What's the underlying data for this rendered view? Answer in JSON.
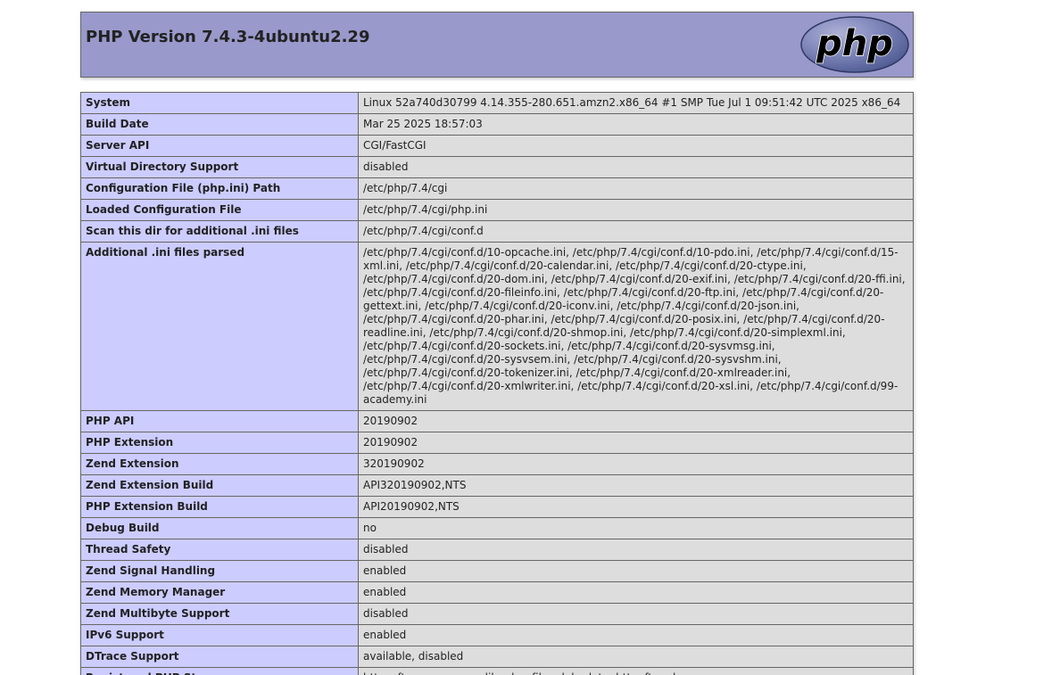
{
  "header": {
    "title": "PHP Version 7.4.3-4ubuntu2.29",
    "logo_text": "php",
    "logo_icon": "php-logo-icon",
    "bg_color": "#9999cc"
  },
  "colors": {
    "label_cell": "#ccccff",
    "value_cell": "#dddddd",
    "border": "#666666"
  },
  "rows": [
    {
      "label": "System",
      "value": "Linux 52a740d30799 4.14.355-280.651.amzn2.x86_64 #1 SMP Tue Jul 1 09:51:42 UTC 2025 x86_64"
    },
    {
      "label": "Build Date",
      "value": "Mar 25 2025 18:57:03"
    },
    {
      "label": "Server API",
      "value": "CGI/FastCGI"
    },
    {
      "label": "Virtual Directory Support",
      "value": "disabled"
    },
    {
      "label": "Configuration File (php.ini) Path",
      "value": "/etc/php/7.4/cgi"
    },
    {
      "label": "Loaded Configuration File",
      "value": "/etc/php/7.4/cgi/php.ini"
    },
    {
      "label": "Scan this dir for additional .ini files",
      "value": "/etc/php/7.4/cgi/conf.d"
    },
    {
      "label": "Additional .ini files parsed",
      "value": "/etc/php/7.4/cgi/conf.d/10-opcache.ini, /etc/php/7.4/cgi/conf.d/10-pdo.ini, /etc/php/7.4/cgi/conf.d/15-xml.ini, /etc/php/7.4/cgi/conf.d/20-calendar.ini, /etc/php/7.4/cgi/conf.d/20-ctype.ini, /etc/php/7.4/cgi/conf.d/20-dom.ini, /etc/php/7.4/cgi/conf.d/20-exif.ini, /etc/php/7.4/cgi/conf.d/20-ffi.ini, /etc/php/7.4/cgi/conf.d/20-fileinfo.ini, /etc/php/7.4/cgi/conf.d/20-ftp.ini, /etc/php/7.4/cgi/conf.d/20-gettext.ini, /etc/php/7.4/cgi/conf.d/20-iconv.ini, /etc/php/7.4/cgi/conf.d/20-json.ini, /etc/php/7.4/cgi/conf.d/20-phar.ini, /etc/php/7.4/cgi/conf.d/20-posix.ini, /etc/php/7.4/cgi/conf.d/20-readline.ini, /etc/php/7.4/cgi/conf.d/20-shmop.ini, /etc/php/7.4/cgi/conf.d/20-simplexml.ini, /etc/php/7.4/cgi/conf.d/20-sockets.ini, /etc/php/7.4/cgi/conf.d/20-sysvmsg.ini, /etc/php/7.4/cgi/conf.d/20-sysvsem.ini, /etc/php/7.4/cgi/conf.d/20-sysvshm.ini, /etc/php/7.4/cgi/conf.d/20-tokenizer.ini, /etc/php/7.4/cgi/conf.d/20-xmlreader.ini, /etc/php/7.4/cgi/conf.d/20-xmlwriter.ini, /etc/php/7.4/cgi/conf.d/20-xsl.ini, /etc/php/7.4/cgi/conf.d/99-academy.ini"
    },
    {
      "label": "PHP API",
      "value": "20190902"
    },
    {
      "label": "PHP Extension",
      "value": "20190902"
    },
    {
      "label": "Zend Extension",
      "value": "320190902"
    },
    {
      "label": "Zend Extension Build",
      "value": "API320190902,NTS"
    },
    {
      "label": "PHP Extension Build",
      "value": "API20190902,NTS"
    },
    {
      "label": "Debug Build",
      "value": "no"
    },
    {
      "label": "Thread Safety",
      "value": "disabled"
    },
    {
      "label": "Zend Signal Handling",
      "value": "enabled"
    },
    {
      "label": "Zend Memory Manager",
      "value": "enabled"
    },
    {
      "label": "Zend Multibyte Support",
      "value": "disabled"
    },
    {
      "label": "IPv6 Support",
      "value": "enabled"
    },
    {
      "label": "DTrace Support",
      "value": "available, disabled"
    },
    {
      "label": "Registered PHP Streams",
      "value": "https, ftps, compress.zlib, php, file, glob, data, http, ftp, phar"
    }
  ]
}
